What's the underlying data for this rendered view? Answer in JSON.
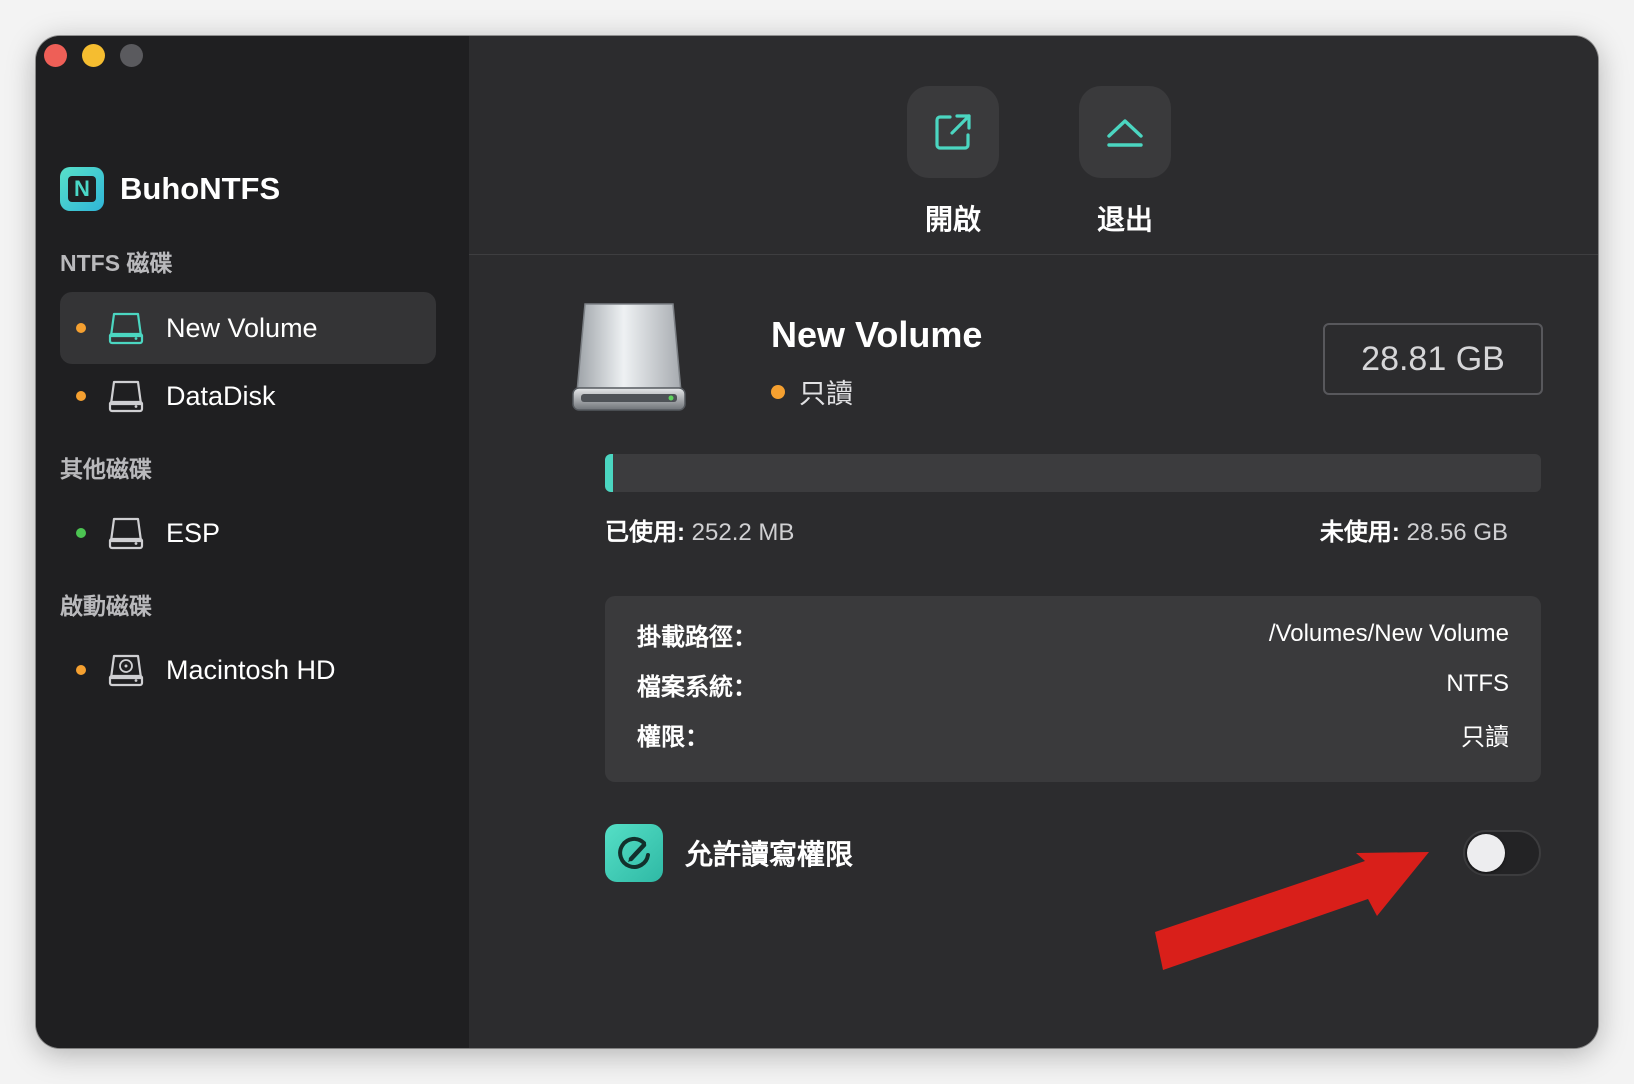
{
  "window": {
    "traffic_lights": [
      "close",
      "minimize",
      "zoom"
    ]
  },
  "sidebar": {
    "app_name": "BuhoNTFS",
    "logo_letter": "N",
    "sections": [
      {
        "label": "NTFS 磁碟",
        "items": [
          {
            "label": "New Volume",
            "status_color": "#f5a030",
            "icon": "external-drive-icon",
            "selected": true
          },
          {
            "label": "DataDisk",
            "status_color": "#f5a030",
            "icon": "external-drive-icon",
            "selected": false
          }
        ]
      },
      {
        "label": "其他磁碟",
        "items": [
          {
            "label": "ESP",
            "status_color": "#4cc452",
            "icon": "external-drive-icon",
            "selected": false
          }
        ]
      },
      {
        "label": "啟動磁碟",
        "items": [
          {
            "label": "Macintosh HD",
            "status_color": "#f5a030",
            "icon": "internal-drive-icon",
            "selected": false
          }
        ]
      }
    ]
  },
  "toolbar": {
    "open_label": "開啟",
    "eject_label": "退出"
  },
  "volume": {
    "name": "New Volume",
    "status": "只讀",
    "status_color": "#f5a030",
    "capacity": "28.81 GB",
    "used_fraction": 0.0088,
    "used_label": "已使用:",
    "used_value": "252.2 MB",
    "free_label": "未使用:",
    "free_value": "28.56 GB"
  },
  "info": {
    "rows": [
      {
        "key": "掛載路徑：",
        "value": "/Volumes/New Volume"
      },
      {
        "key": "檔案系統：",
        "value": "NTFS"
      },
      {
        "key": "權限：",
        "value": "只讀"
      }
    ]
  },
  "read_write": {
    "label": "允許讀寫權限",
    "enabled": false
  },
  "colors": {
    "accent": "#4bd6c1",
    "annotation_arrow": "#d91f1a"
  }
}
